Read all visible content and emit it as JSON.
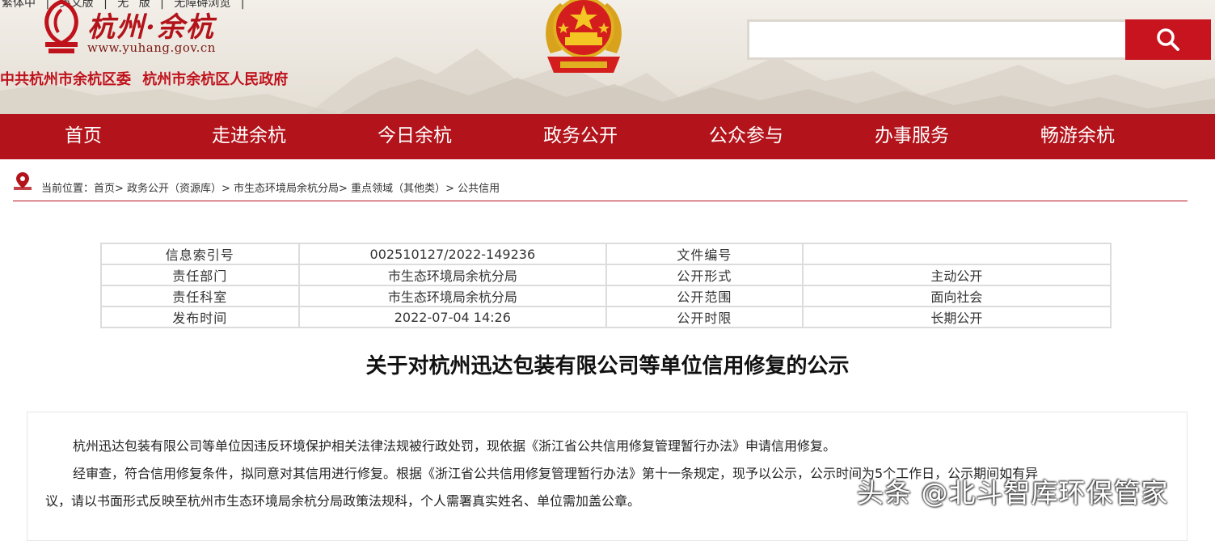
{
  "header": {
    "top_links": [
      "繁体中",
      "|",
      "英文版",
      "|",
      "无",
      "版",
      "|",
      "无障碍浏览",
      "|"
    ],
    "logo_title": "杭州·余杭",
    "logo_url": "www.yuhang.gov.cn",
    "org_left": "中共杭州市余杭区委",
    "org_right": "杭州市余杭区人民政府",
    "search_placeholder": ""
  },
  "nav": [
    "首页",
    "走进余杭",
    "今日余杭",
    "政务公开",
    "公众参与",
    "办事服务",
    "畅游余杭"
  ],
  "breadcrumb": "当前位置：首页> 政务公开（资源库）> 市生态环境局余杭分局> 重点领域（其他类）> 公共信用",
  "meta": {
    "rows": [
      {
        "l1": "信息索引号",
        "v1": "002510127/2022-149236",
        "l2": "文件编号",
        "v2": ""
      },
      {
        "l1": "责任部门",
        "v1": "市生态环境局余杭分局",
        "l2": "公开形式",
        "v2": "主动公开"
      },
      {
        "l1": "责任科室",
        "v1": "市生态环境局余杭分局",
        "l2": "公开范围",
        "v2": "面向社会"
      },
      {
        "l1": "发布时间",
        "v1": "2022-07-04 14:26",
        "l2": "公开时限",
        "v2": "长期公开"
      }
    ]
  },
  "article": {
    "title": "关于对杭州迅达包装有限公司等单位信用修复的公示",
    "p1": "杭州迅达包装有限公司等单位因违反环境保护相关法律法规被行政处罚，现依据《浙江省公共信用修复管理暂行办法》申请信用修复。",
    "p2": "经审查，符合信用修复条件，拟同意对其信用进行修复。根据《浙江省公共信用修复管理暂行办法》第十一条规定，现予以公示，公示时间为5个工作日，公示期间如有异",
    "p3": "议，请以书面形式反映至杭州市生态环境局余杭分局政策法规科，个人需署真实姓名、单位需加盖公章。"
  },
  "watermark": "头条 @北斗智库环保管家",
  "colors": {
    "brand_red": "#b3131a",
    "search_red": "#c8141e"
  }
}
